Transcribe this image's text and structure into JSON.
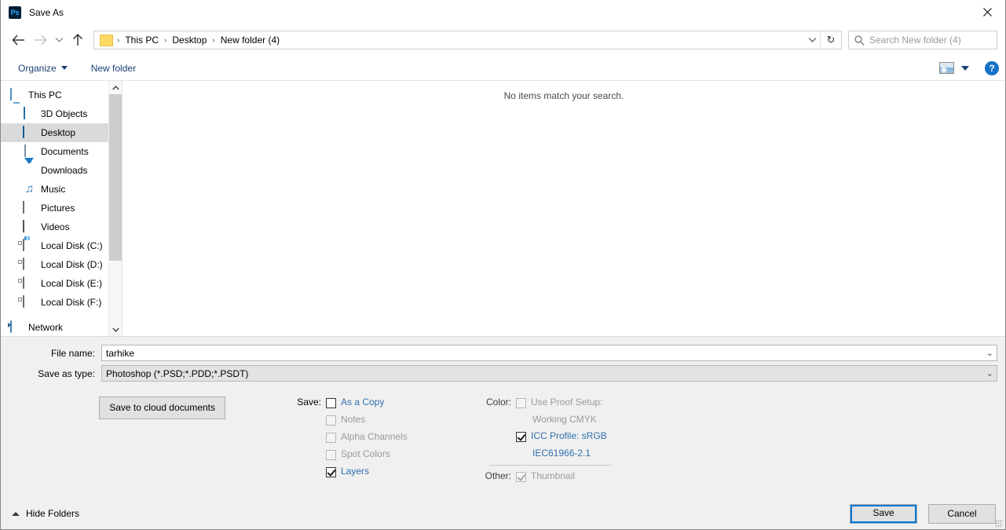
{
  "window": {
    "app_icon": "photoshop-icon",
    "title": "Save As",
    "close_label": "✕"
  },
  "nav": {
    "back_icon": "arrow-left-icon",
    "forward_icon": "arrow-right-icon",
    "recent_icon": "chevron-down-icon",
    "up_icon": "arrow-up-icon",
    "refresh_icon": "↻",
    "breadcrumbs": [
      "This PC",
      "Desktop",
      "New folder (4)"
    ],
    "separator": "›",
    "dropdown_icon": "⌄"
  },
  "search": {
    "icon": "search-icon",
    "placeholder": "Search New folder (4)"
  },
  "toolbar": {
    "organize_label": "Organize",
    "new_folder_label": "New folder",
    "view_icon": "view-mode-icon",
    "view_caret": "chevron-down-icon",
    "help_label": "?"
  },
  "sidebar": {
    "items": [
      {
        "label": "This PC",
        "icon": "computer-icon",
        "indent": false,
        "selected": false
      },
      {
        "label": "3D Objects",
        "icon": "3d-objects-icon",
        "indent": true,
        "selected": false
      },
      {
        "label": "Desktop",
        "icon": "desktop-icon",
        "indent": true,
        "selected": true
      },
      {
        "label": "Documents",
        "icon": "documents-icon",
        "indent": true,
        "selected": false
      },
      {
        "label": "Downloads",
        "icon": "downloads-icon",
        "indent": true,
        "selected": false
      },
      {
        "label": "Music",
        "icon": "music-icon",
        "indent": true,
        "selected": false
      },
      {
        "label": "Pictures",
        "icon": "pictures-icon",
        "indent": true,
        "selected": false
      },
      {
        "label": "Videos",
        "icon": "videos-icon",
        "indent": true,
        "selected": false
      },
      {
        "label": "Local Disk (C:)",
        "icon": "system-disk-icon",
        "indent": true,
        "selected": false
      },
      {
        "label": "Local Disk (D:)",
        "icon": "disk-icon",
        "indent": true,
        "selected": false
      },
      {
        "label": "Local Disk (E:)",
        "icon": "disk-icon",
        "indent": true,
        "selected": false
      },
      {
        "label": "Local Disk (F:)",
        "icon": "disk-icon",
        "indent": true,
        "selected": false
      },
      {
        "label": "Network",
        "icon": "network-icon",
        "indent": false,
        "selected": false
      }
    ],
    "scroll_up_icon": "ⱏ",
    "scroll_down_icon": "ⱟ"
  },
  "filelist": {
    "empty_message": "No items match your search."
  },
  "form": {
    "file_name_label": "File name:",
    "file_name_value": "tarhike",
    "save_as_type_label": "Save as type:",
    "save_as_type_value": "Photoshop (*.PSD;*.PDD;*.PSDT)",
    "combo_arrow": "⌄"
  },
  "options": {
    "cloud_button_label": "Save to cloud documents",
    "save_group_label": "Save:",
    "save_items": [
      {
        "label": "As a Copy",
        "checked": false,
        "disabled": false
      },
      {
        "label": "Notes",
        "checked": false,
        "disabled": true
      },
      {
        "label": "Alpha Channels",
        "checked": false,
        "disabled": true
      },
      {
        "label": "Spot Colors",
        "checked": false,
        "disabled": true
      },
      {
        "label": "Layers",
        "checked": true,
        "disabled": false
      }
    ],
    "color_group_label": "Color:",
    "proof_setup_label": "Use Proof Setup:",
    "proof_setup_sub": "Working CMYK",
    "proof_setup_checked": false,
    "proof_setup_disabled": true,
    "icc_profile_label": "ICC Profile:  sRGB",
    "icc_profile_sub": "IEC61966-2.1",
    "icc_profile_checked": true,
    "other_group_label": "Other:",
    "thumbnail_label": "Thumbnail",
    "thumbnail_checked": true,
    "thumbnail_disabled": true
  },
  "footer": {
    "hide_folders_label": "Hide Folders",
    "hide_folders_icon": "chevron-up-icon",
    "save_label": "Save",
    "cancel_label": "Cancel"
  },
  "colors": {
    "accent_link": "#2f6fad",
    "focus_blue": "#0078d7",
    "selection_gray": "#dadada",
    "toolbar_navy": "#1c3f73"
  }
}
